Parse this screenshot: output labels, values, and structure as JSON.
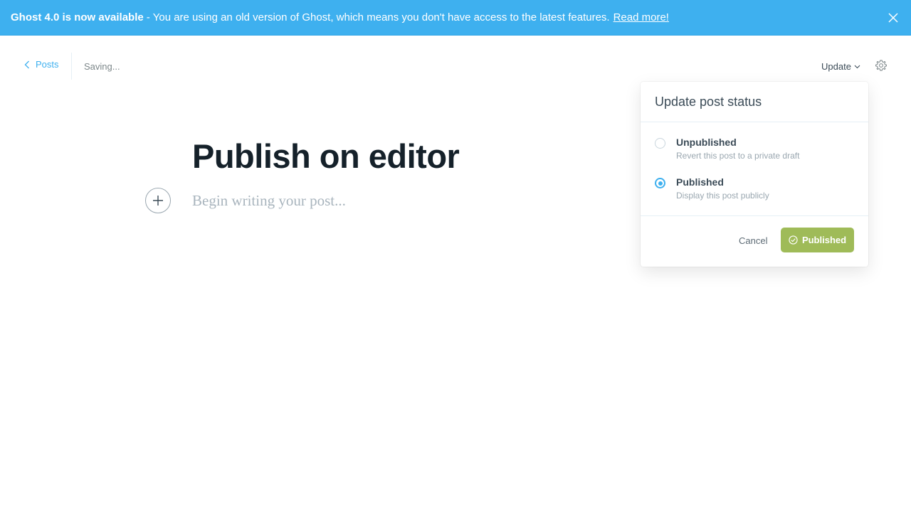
{
  "banner": {
    "bold": "Ghost 4.0 is now available",
    "separator": "-",
    "message": "You are using an old version of Ghost, which means you don't have access to the latest features.",
    "link": "Read more!",
    "close_icon": "close-icon",
    "color": "#3eb0ef"
  },
  "topbar": {
    "back_label": "Posts",
    "status": "Saving...",
    "update_label": "Update",
    "settings_icon": "gear-icon"
  },
  "editor": {
    "title": "Publish on editor",
    "placeholder": "Begin writing your post..."
  },
  "popover": {
    "title": "Update post status",
    "options": [
      {
        "label": "Unpublished",
        "description": "Revert this post to a private draft",
        "selected": false
      },
      {
        "label": "Published",
        "description": "Display this post publicly",
        "selected": true
      }
    ],
    "cancel_label": "Cancel",
    "confirm_label": "Published",
    "confirm_color": "#9fbb58"
  }
}
